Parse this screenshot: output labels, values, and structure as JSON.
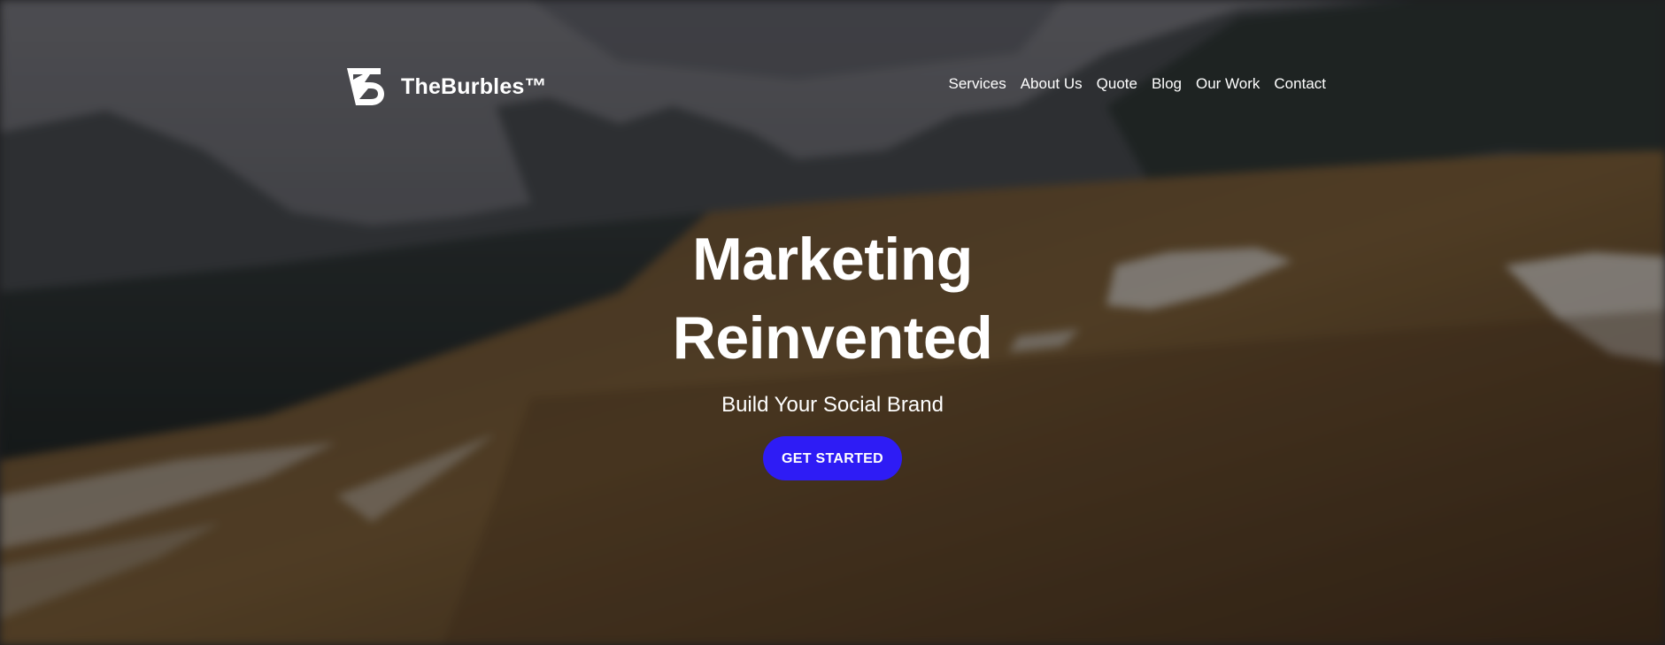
{
  "brand": {
    "name": "TheBurbles™",
    "logo_icon": "tb-monogram-icon"
  },
  "nav": {
    "items": [
      {
        "label": "Services"
      },
      {
        "label": "About Us"
      },
      {
        "label": "Quote"
      },
      {
        "label": "Blog"
      },
      {
        "label": "Our Work"
      },
      {
        "label": "Contact"
      }
    ]
  },
  "hero": {
    "title_line1": "Marketing",
    "title_line2": "Reinvented",
    "subtitle": "Build Your Social Brand",
    "cta_label": "GET STARTED",
    "background": "mountain-meadow-video-background"
  },
  "colors": {
    "cta_background": "#2e1cf5",
    "text": "#ffffff"
  }
}
